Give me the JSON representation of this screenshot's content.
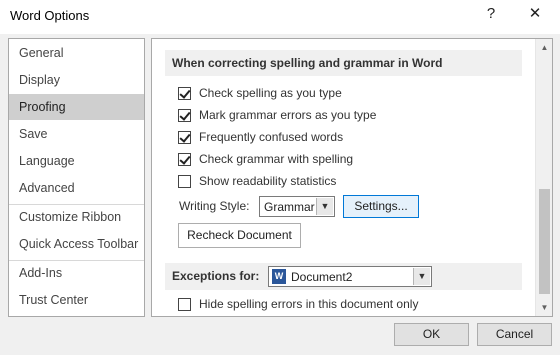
{
  "window": {
    "title": "Word Options",
    "help_glyph": "?",
    "close_glyph": "✕"
  },
  "sidebar": {
    "items": [
      {
        "label": "General"
      },
      {
        "label": "Display"
      },
      {
        "label": "Proofing",
        "selected": true
      },
      {
        "label": "Save"
      },
      {
        "label": "Language"
      },
      {
        "label": "Advanced"
      },
      {
        "label": "Customize Ribbon"
      },
      {
        "label": "Quick Access Toolbar"
      },
      {
        "label": "Add-Ins"
      },
      {
        "label": "Trust Center"
      }
    ]
  },
  "main": {
    "section_title": "When correcting spelling and grammar in Word",
    "options": [
      {
        "label": "Check spelling as you type",
        "checked": true
      },
      {
        "label": "Mark grammar errors as you type",
        "checked": true
      },
      {
        "label": "Frequently confused words",
        "checked": true
      },
      {
        "label": "Check grammar with spelling",
        "checked": true
      },
      {
        "label": "Show readability statistics",
        "checked": false
      }
    ],
    "writing_style_label": "Writing Style:",
    "writing_style_value": "Grammar",
    "settings_button": "Settings...",
    "recheck_button": "Recheck Document",
    "exceptions_label": "Exceptions for:",
    "exceptions_value": "Document2",
    "hide_errors": {
      "label": "Hide spelling errors in this document only",
      "checked": false
    }
  },
  "footer": {
    "ok_label": "OK",
    "cancel_label": "Cancel"
  },
  "colors": {
    "selection": "#cfcfcf",
    "focus_border": "#0078d7",
    "word_blue": "#2b579a"
  }
}
